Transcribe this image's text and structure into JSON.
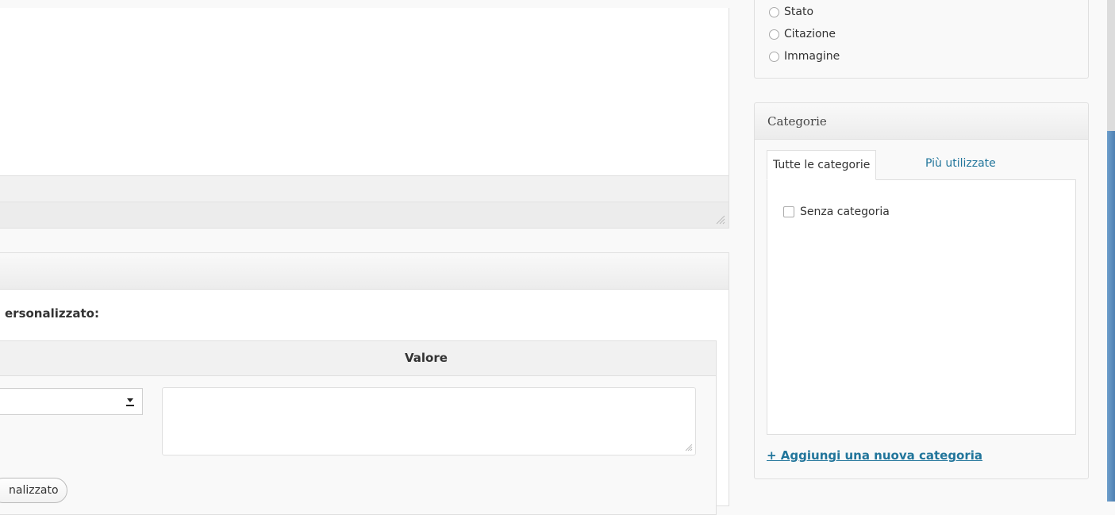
{
  "custom_fields": {
    "add_new_label": "ersonalizzato:",
    "value_header": "Valore",
    "value_placeholder": "",
    "add_button_label": "nalizzato"
  },
  "format": {
    "options": [
      "Stato",
      "Citazione",
      "Immagine"
    ]
  },
  "categories": {
    "title": "Categorie",
    "tab_all": "Tutte le categorie",
    "tab_popular": "Più utilizzate",
    "items": [
      "Senza categoria"
    ],
    "add_link": "+ Aggiungi una nuova categoria"
  },
  "colors": {
    "link": "#21759b",
    "scrollbar_thumb": "#5b8fbf"
  }
}
